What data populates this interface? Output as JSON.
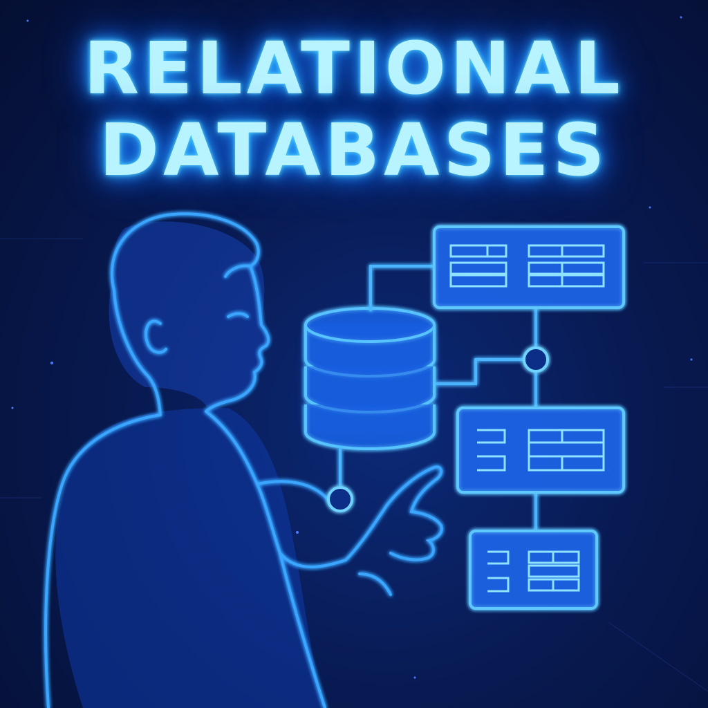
{
  "title": {
    "line1": "RELATIONAL",
    "line2": "DATABASES"
  },
  "colors": {
    "background": "#06133a",
    "glow": "#3fa9ff",
    "title": "#b8f4ff"
  },
  "icons": {
    "database": "database-cylinder-icon",
    "table": "table-card-icon",
    "node": "connector-node-icon"
  }
}
